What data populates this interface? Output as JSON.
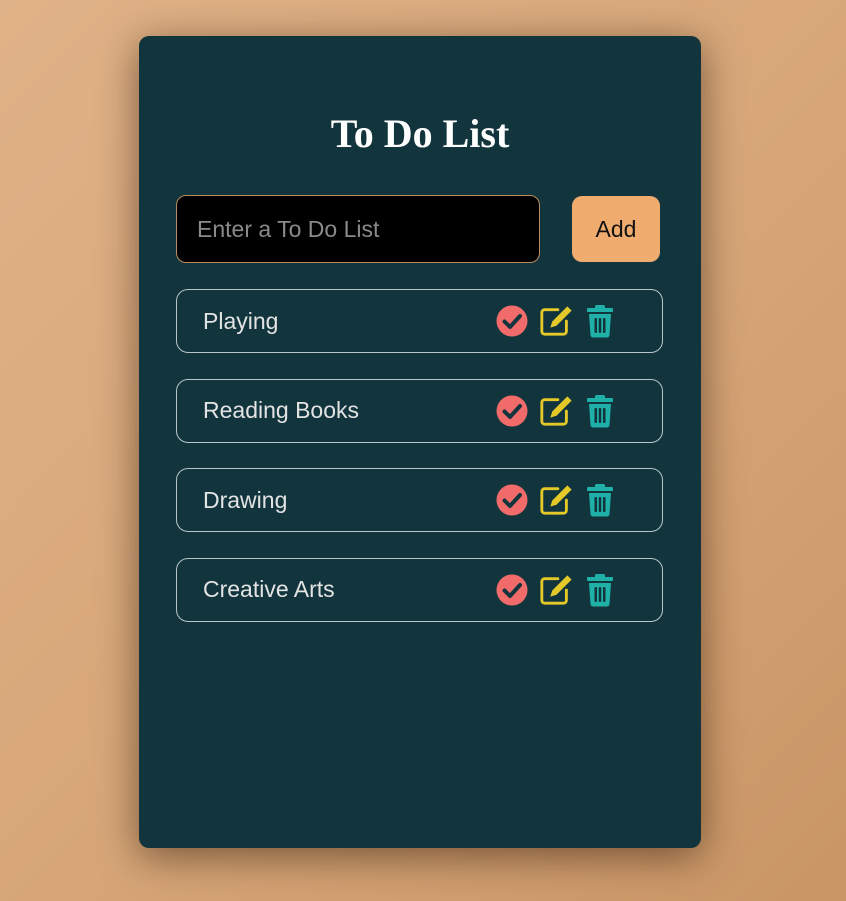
{
  "app": {
    "title": "To Do List"
  },
  "input": {
    "placeholder": "Enter a To Do List",
    "value": ""
  },
  "add_button": {
    "label": "Add"
  },
  "todos": [
    {
      "label": "Playing"
    },
    {
      "label": "Reading Books"
    },
    {
      "label": "Drawing"
    },
    {
      "label": "Creative Arts"
    }
  ],
  "item_icons": [
    "check-circle-icon",
    "edit-icon",
    "trash-icon"
  ],
  "colors": {
    "page_bg": "#d8a877",
    "card_bg": "#12353d",
    "add_button": "#f0ac6f",
    "check_icon": "#f26b6b",
    "edit_icon": "#e4c928",
    "trash_icon": "#1fb0a8"
  }
}
